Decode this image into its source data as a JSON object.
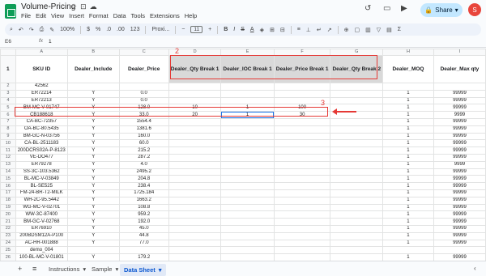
{
  "app": {
    "title": "Volume-Pricing",
    "menu": [
      "File",
      "Edit",
      "View",
      "Insert",
      "Format",
      "Data",
      "Tools",
      "Extensions",
      "Help"
    ],
    "share_label": "Share",
    "avatar_letter": "S"
  },
  "toolbar": {
    "zoom": "100%",
    "currency": "$",
    "percent": "%",
    "dec_less": ".0",
    "dec_more": ".00",
    "number_format": "123",
    "font": "Proxi...",
    "font_size": "11"
  },
  "formula_bar": {
    "cell_ref": "E6",
    "fx": "fx",
    "value": "1"
  },
  "sheet": {
    "col_letters": [
      "A",
      "B",
      "C",
      "D",
      "E",
      "F",
      "G",
      "H",
      "I"
    ],
    "headers": [
      "SKU ID",
      "Dealer_Include",
      "Dealer_Price",
      "Dealer_Qty Break 1",
      "Dealer_IOC Break 1",
      "Dealer_Price Break 1",
      "Dealer_Qty Break 2",
      "Dealer_MOQ",
      "Dealer_Max qty"
    ],
    "rows": [
      {
        "n": "2",
        "a": "42562",
        "b": "",
        "c": "",
        "d": "",
        "e": "",
        "f": "",
        "h": "",
        "i": ""
      },
      {
        "n": "3",
        "a": "ER72214",
        "b": "Y",
        "c": "0.0",
        "d": "",
        "e": "",
        "f": "",
        "h": "1",
        "i": "99999"
      },
      {
        "n": "4",
        "a": "ER72213",
        "b": "Y",
        "c": "0.0",
        "d": "",
        "e": "",
        "f": "",
        "h": "1",
        "i": "99999"
      },
      {
        "n": "5",
        "a": "BM-MC-V-01747",
        "b": "Y",
        "c": "128.0",
        "d": "10",
        "e": "1",
        "f": "100",
        "h": "1",
        "i": "99999"
      },
      {
        "n": "6",
        "a": "CB188618",
        "b": "Y",
        "c": "33.0",
        "d": "20",
        "e": "1",
        "f": "30",
        "h": "1",
        "i": "9999"
      },
      {
        "n": "7",
        "a": "CA-BC-72357",
        "b": "Y",
        "c": "1554.4",
        "d": "",
        "e": "",
        "f": "",
        "h": "1",
        "i": "99999"
      },
      {
        "n": "8",
        "a": "OA-BC-80.5435",
        "b": "Y",
        "c": "1381.6",
        "d": "",
        "e": "",
        "f": "",
        "h": "1",
        "i": "99999"
      },
      {
        "n": "9",
        "a": "BM-GC-N-03756",
        "b": "Y",
        "c": "160.0",
        "d": "",
        "e": "",
        "f": "",
        "h": "1",
        "i": "99999"
      },
      {
        "n": "10",
        "a": "CA-BL-2511183",
        "b": "Y",
        "c": "60.0",
        "d": "",
        "e": "",
        "f": "",
        "h": "1",
        "i": "99999"
      },
      {
        "n": "11",
        "a": "200DCRS02A-P-8123",
        "b": "Y",
        "c": "215.2",
        "d": "",
        "e": "",
        "f": "",
        "h": "1",
        "i": "99999"
      },
      {
        "n": "12",
        "a": "VE-DO477",
        "b": "Y",
        "c": "287.2",
        "d": "",
        "e": "",
        "f": "",
        "h": "1",
        "i": "99999"
      },
      {
        "n": "13",
        "a": "ER79278",
        "b": "Y",
        "c": "4.0",
        "d": "",
        "e": "",
        "f": "",
        "h": "1",
        "i": "9999"
      },
      {
        "n": "14",
        "a": "SS-3C-103.5362",
        "b": "Y",
        "c": "2495.2",
        "d": "",
        "e": "",
        "f": "",
        "h": "1",
        "i": "99999"
      },
      {
        "n": "15",
        "a": "BL-MC-V-03849",
        "b": "Y",
        "c": "204.8",
        "d": "",
        "e": "",
        "f": "",
        "h": "1",
        "i": "99999"
      },
      {
        "n": "16",
        "a": "BL-SE525",
        "b": "Y",
        "c": "238.4",
        "d": "",
        "e": "",
        "f": "",
        "h": "1",
        "i": "99999"
      },
      {
        "n": "17",
        "a": "FM-24-BR-T2-MILK",
        "b": "Y",
        "c": "1725.184",
        "d": "",
        "e": "",
        "f": "",
        "h": "1",
        "i": "99999"
      },
      {
        "n": "18",
        "a": "WH-2C-95.5442",
        "b": "Y",
        "c": "1663.2",
        "d": "",
        "e": "",
        "f": "",
        "h": "1",
        "i": "99999"
      },
      {
        "n": "19",
        "a": "WG-MC-V-02701",
        "b": "Y",
        "c": "108.8",
        "d": "",
        "e": "",
        "f": "",
        "h": "1",
        "i": "99999"
      },
      {
        "n": "20",
        "a": "WW-3C-87400",
        "b": "Y",
        "c": "959.2",
        "d": "",
        "e": "",
        "f": "",
        "h": "1",
        "i": "99999"
      },
      {
        "n": "21",
        "a": "BM-GC-V-02768",
        "b": "Y",
        "c": "192.0",
        "d": "",
        "e": "",
        "f": "",
        "h": "1",
        "i": "99999"
      },
      {
        "n": "22",
        "a": "ER76910",
        "b": "Y",
        "c": "45.0",
        "d": "",
        "e": "",
        "f": "",
        "h": "1",
        "i": "99999"
      },
      {
        "n": "23",
        "a": "200BDSM12A-P100",
        "b": "Y",
        "c": "44.8",
        "d": "",
        "e": "",
        "f": "",
        "h": "1",
        "i": "99999"
      },
      {
        "n": "24",
        "a": "AC-HR-001888",
        "b": "Y",
        "c": "77.0",
        "d": "",
        "e": "",
        "f": "",
        "h": "1",
        "i": "99999"
      },
      {
        "n": "25",
        "a": "demo_004",
        "b": "",
        "c": "",
        "d": "",
        "e": "",
        "f": "",
        "h": "",
        "i": ""
      },
      {
        "n": "26",
        "a": "100-BL-MC-V-01801",
        "b": "Y",
        "c": "179.2",
        "d": "",
        "e": "",
        "f": "",
        "h": "1",
        "i": "99999"
      },
      {
        "n": "27",
        "a": "200BIVO00A-P-8150",
        "b": "Y",
        "c": "60.8",
        "d": "",
        "e": "",
        "f": "",
        "h": "1",
        "i": "99999"
      }
    ]
  },
  "annotations": {
    "label_2": "2",
    "label_3": "3",
    "label_1": "1"
  },
  "tabs": [
    {
      "label": "Instructions",
      "active": false
    },
    {
      "label": "Sample",
      "active": false
    },
    {
      "label": "Data Sheet",
      "active": true
    }
  ],
  "colors": {
    "annotation": "#e53935",
    "selection": "#1a73e8",
    "share_bg": "#c2e7ff"
  }
}
